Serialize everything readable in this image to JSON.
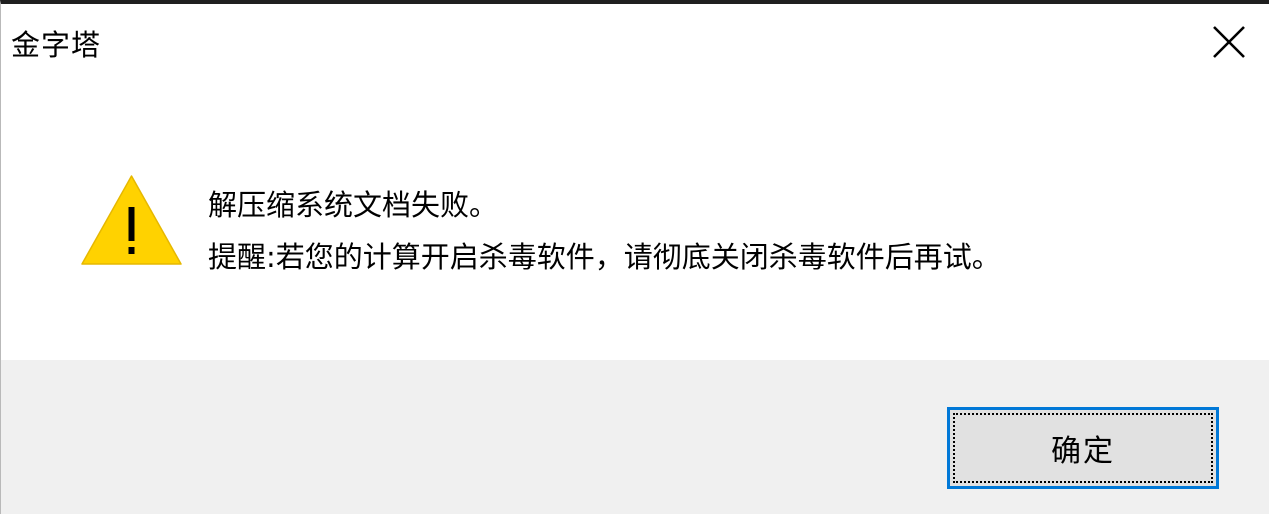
{
  "dialog": {
    "title": "金字塔",
    "close_icon": "close-icon",
    "warning_icon": "warning-icon",
    "message_line1": "解压缩系统文档失败。",
    "message_line2": "提醒:若您的计算开启杀毒软件，请彻底关闭杀毒软件后再试。",
    "ok_label": "确定"
  },
  "colors": {
    "warning_fill": "#FFD200",
    "warning_glyph": "#000000",
    "button_border": "#0078D7",
    "footer_bg": "#F0F0F0"
  }
}
